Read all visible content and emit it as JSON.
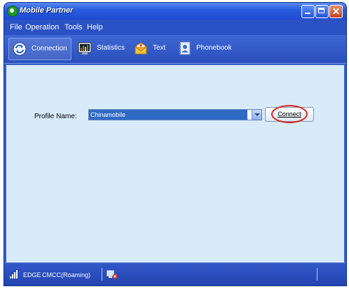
{
  "window": {
    "title": "Mobile Partner",
    "controls": {
      "minimize_icon": "minimize-icon",
      "maximize_icon": "maximize-icon",
      "close_icon": "close-icon",
      "close_glyph": "✕"
    }
  },
  "menu": {
    "items": [
      {
        "label": "File"
      },
      {
        "label": "Operation"
      },
      {
        "label": "Tools"
      },
      {
        "label": "Help"
      }
    ]
  },
  "toolbar": {
    "buttons": [
      {
        "label": "Connection",
        "icon": "connection-icon",
        "active": true
      },
      {
        "label": "Statistics",
        "icon": "statistics-icon",
        "active": false
      },
      {
        "label": "Text",
        "icon": "envelope-icon",
        "active": false
      },
      {
        "label": "Phonebook",
        "icon": "phonebook-icon",
        "active": false
      }
    ]
  },
  "main": {
    "profile_label": "Profile Name:",
    "profile_value": "Chinamobile",
    "connect_label": "Connect"
  },
  "status": {
    "network": "EDGE",
    "operator": "CMCC(Roaming)"
  },
  "colors": {
    "title_bar": "#2a5ce0",
    "content_bg": "#d8ebfb",
    "selection": "#316ac5",
    "highlight_ring": "#d9261c"
  }
}
